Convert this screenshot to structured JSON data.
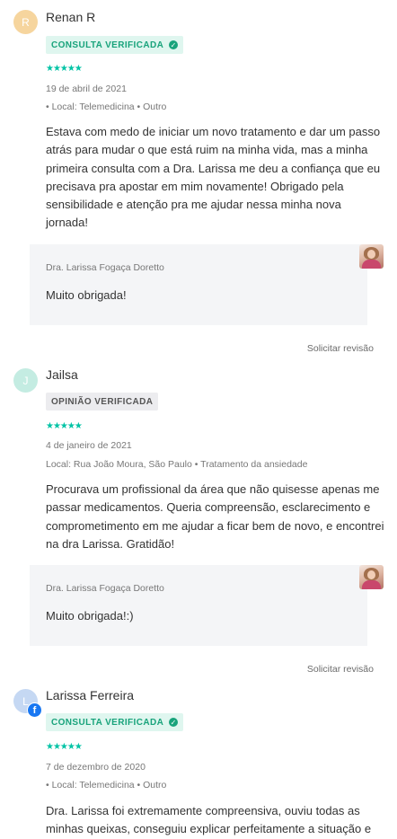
{
  "reviews": [
    {
      "avatar_initial": "R",
      "avatar_color": "#f6d59e",
      "name": "Renan R",
      "badge": "CONSULTA VERIFICADA",
      "badge_style": "green",
      "stars": "★★★★★",
      "date": "19 de abril de 2021",
      "location": "• Local: Telemedicina • Outro",
      "text": "Estava com medo de iniciar um novo tratamento e dar um passo atrás para mudar o que está ruim na minha vida, mas a minha primeira consulta com a Dra. Larissa me deu a confiança que eu precisava pra apostar em mim novamente! Obrigado pela sensibilidade e atenção pra me ajudar nessa minha nova jornada!",
      "reply_doctor": "Dra. Larissa Fogaça Doretto",
      "reply_text": "Muito obrigada!",
      "action": "Solicitar revisão"
    },
    {
      "avatar_initial": "J",
      "avatar_color": "#c4ece2",
      "name": "Jailsa",
      "badge": "OPINIÃO VERIFICADA",
      "badge_style": "gray",
      "stars": "★★★★★",
      "date": "4 de janeiro de 2021",
      "location": "Local: Rua João Moura, São Paulo • Tratamento da ansiedade",
      "text": "Procurava um profissional da área que não quisesse apenas me passar medicamentos. Queria compreensão, esclarecimento e comprometimento em me ajudar a ficar bem de novo, e encontrei na dra Larissa. Gratidão!",
      "reply_doctor": "Dra. Larissa Fogaça Doretto",
      "reply_text": "Muito obrigada!:)",
      "action": "Solicitar revisão"
    },
    {
      "avatar_initial": "L",
      "avatar_color": "#c5d8f3",
      "name": "Larissa Ferreira",
      "badge": "CONSULTA VERIFICADA",
      "badge_style": "green",
      "stars": "★★★★★",
      "date": "7 de dezembro de 2020",
      "location": "• Local: Telemedicina • Outro",
      "text": "Dra. Larissa foi extremamente compreensiva, ouviu todas as minhas queixas, conseguiu explicar perfeitamente a situação e"
    }
  ],
  "icons": {
    "verified": "check-circle-icon",
    "facebook": "facebook-icon",
    "doctor_photo": "doctor-avatar"
  }
}
